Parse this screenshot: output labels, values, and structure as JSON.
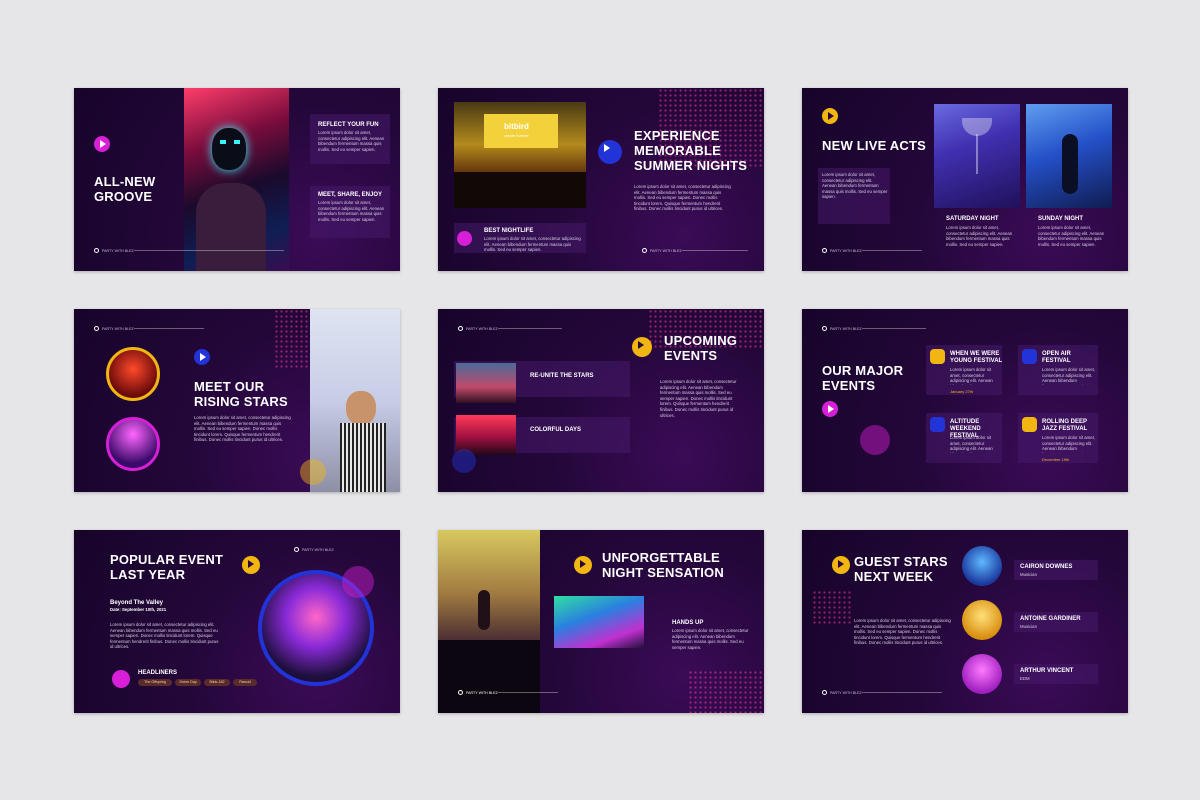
{
  "footer_label": "PARTY WITH BLEZ",
  "lorem_short": "Lorem ipsum dolor sit amet, consectetur adipiscing elit. Aenean bibendum fermentum massa quis mollis. Sed eu semper sapien.",
  "lorem_long": "Lorem ipsum dolor sit amet, consectetur adipiscing elit. Aenean bibendum fermentum massa quis mollis. Sed eu semper sapien. Donec mollis tincidunt lorem. Quisque fermentum hendrerit finibus. Donec mollis tincidunt purus id ultrices.",
  "slide1": {
    "title": "ALL-NEW GROOVE",
    "h1": "REFLECT YOUR FUN",
    "h2": "MEET, SHARE, ENJOY"
  },
  "slide2": {
    "title": "EXPERIENCE MEMORABLE SUMMER NIGHTS",
    "screen_brand": "bitbird",
    "screen_tag": "create forever.",
    "card_title": "BEST NIGHTLIFE"
  },
  "slide3": {
    "title": "NEW LIVE ACTS",
    "col1": "SATURDAY NIGHT",
    "col2": "SUNDAY NIGHT"
  },
  "slide4": {
    "title": "MEET OUR RISING STARS"
  },
  "slide5": {
    "title": "UPCOMING EVENTS",
    "item1": "RE-UNITE THE STARS",
    "item2": "COLORFUL DAYS"
  },
  "slide6": {
    "title": "OUR MAJOR EVENTS",
    "events": [
      {
        "name": "WHEN WE WERE YOUNG FESTIVAL",
        "date": "January 27th"
      },
      {
        "name": "OPEN AIR FESTIVAL",
        "date": ""
      },
      {
        "name": "ALTITUDE WEEKEND FESTIVAL",
        "date": ""
      },
      {
        "name": "ROLLING DEEP JAZZ FESTIVAL",
        "date": "December 19th"
      }
    ]
  },
  "slide7": {
    "title": "POPULAR EVENT LAST YEAR",
    "event": "Beyond The Valley",
    "date": "Date: September 10th, 2021",
    "headliners": "HEADLINERS",
    "bands": [
      "The Offspring",
      "Green Day",
      "Blink-182",
      "Rancid"
    ]
  },
  "slide8": {
    "title": "UNFORGETTABLE NIGHT SENSATION",
    "caption": "HANDS UP"
  },
  "slide9": {
    "title": "GUEST STARS NEXT WEEK",
    "guests": [
      {
        "name": "CAIRON DOWNES",
        "role": "Musician"
      },
      {
        "name": "ANTOINE GARDINER",
        "role": "Musician"
      },
      {
        "name": "ARTHUR VINCENT",
        "role": "EDM"
      }
    ]
  },
  "colors": {
    "accent_pink": "#d61fd6",
    "accent_blue": "#2233d8",
    "accent_yellow": "#f1b612",
    "bg_dark": "#17042a"
  }
}
